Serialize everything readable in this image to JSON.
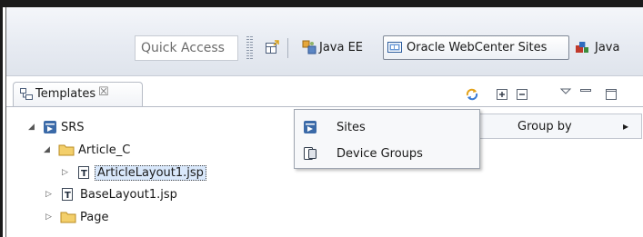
{
  "toolbar": {
    "quick_access_placeholder": "Quick Access",
    "perspectives": [
      {
        "label": "Java EE",
        "active": false
      },
      {
        "label": "Oracle WebCenter Sites",
        "active": true
      },
      {
        "label": "Java",
        "active": false
      }
    ]
  },
  "view": {
    "tab_label": "Templates",
    "close_glyph": "☒"
  },
  "tree": {
    "items": [
      {
        "label": "SRS",
        "type": "site",
        "expanded": true
      },
      {
        "label": "Article_C",
        "type": "folder",
        "expanded": true
      },
      {
        "label": "ArticleLayout1.jsp",
        "type": "template",
        "expanded": false,
        "selected": true
      },
      {
        "label": "BaseLayout1.jsp",
        "type": "template",
        "expanded": false
      },
      {
        "label": "Page",
        "type": "folder",
        "expanded": false
      }
    ]
  },
  "menu": {
    "items": [
      {
        "label": "Sites",
        "icon": "site-icon"
      },
      {
        "label": "Device Groups",
        "icon": "device-groups-icon"
      }
    ],
    "submenu_label": "Group by",
    "submenu_arrow": "▸"
  },
  "colors": {
    "selection": "#d9e8fb",
    "folder": "#e8c25a",
    "site_icon": "#3b6aa8"
  }
}
